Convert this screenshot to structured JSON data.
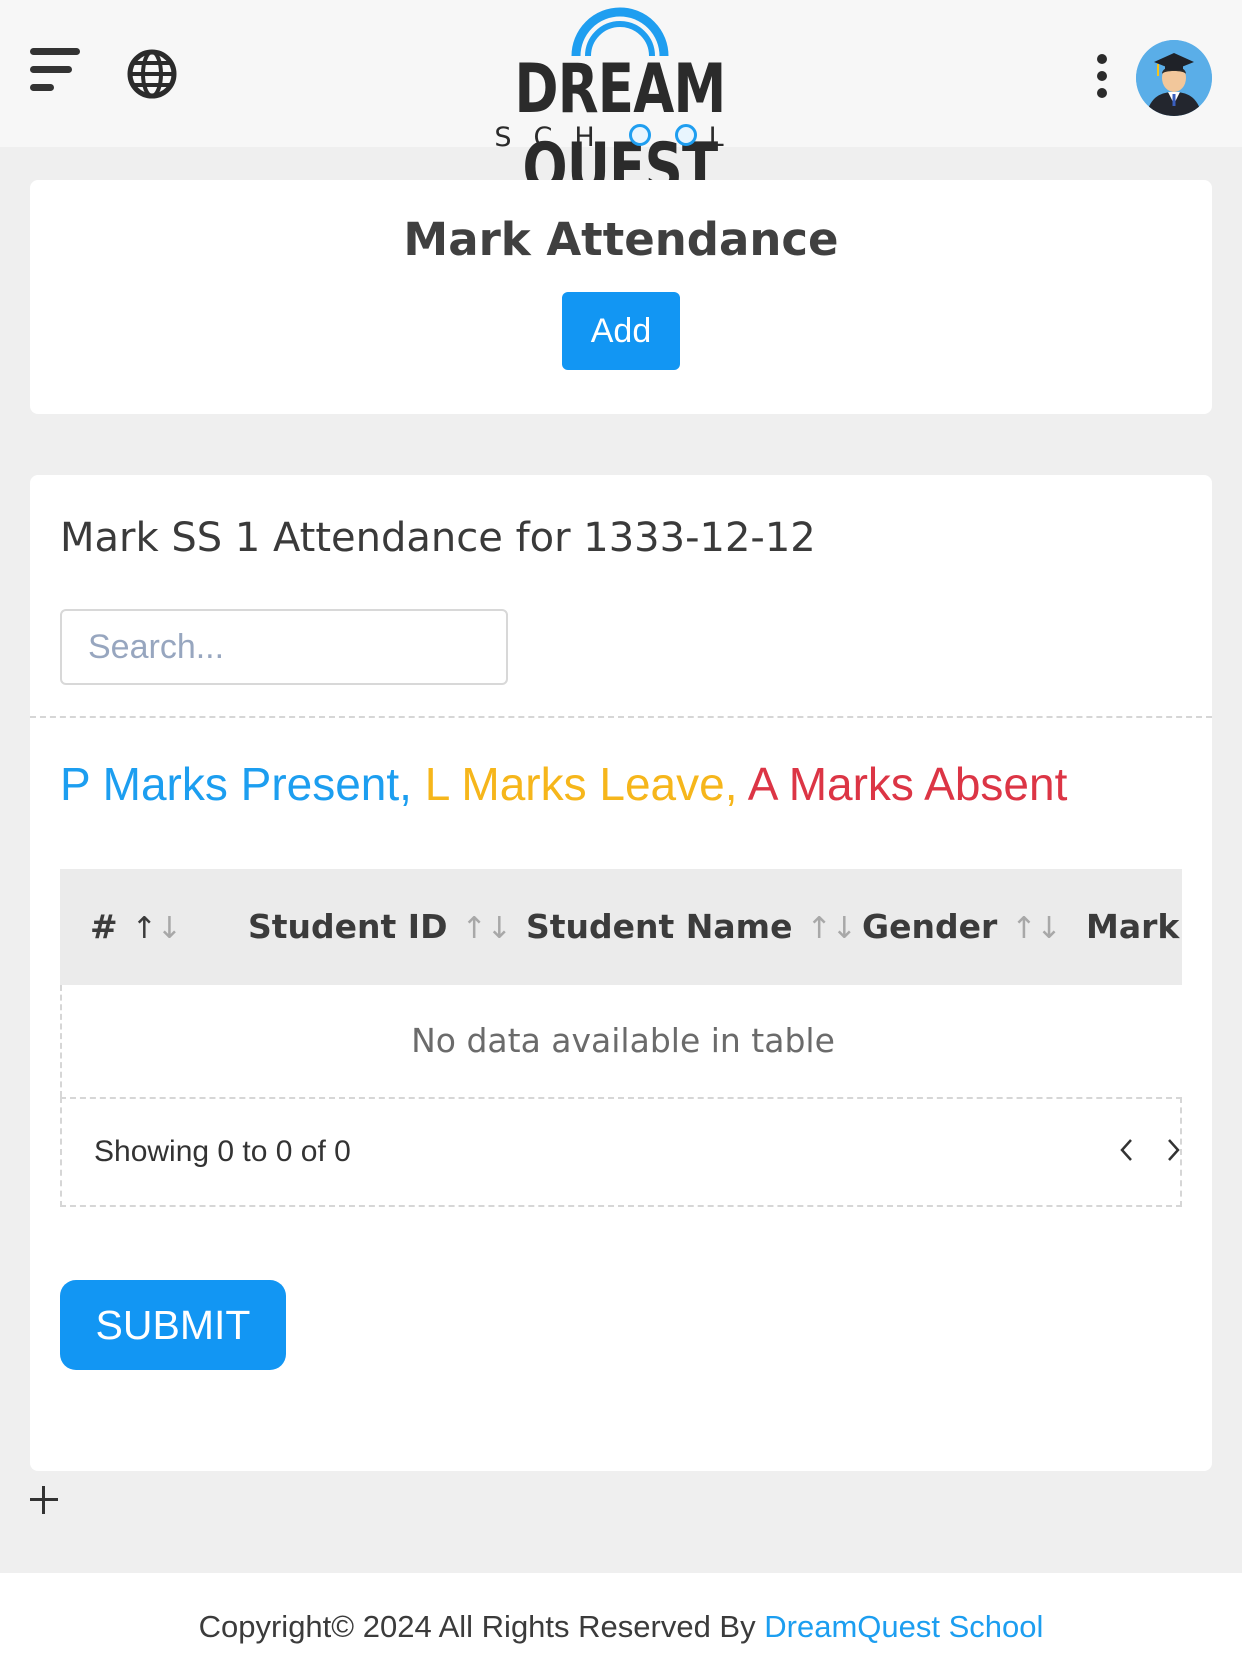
{
  "header": {
    "logo_title": "DREAM QUEST",
    "logo_sub_prefix": "SCH",
    "logo_sub_suffix": "L"
  },
  "attendance_card": {
    "title": "Mark Attendance",
    "add_label": "Add"
  },
  "table_section": {
    "title": "Mark SS 1 Attendance for 1333-12-12",
    "search_placeholder": "Search...",
    "legend": {
      "present": "P Marks Present,",
      "leave": "L Marks Leave,",
      "absent": "A Marks Absent",
      "colors": {
        "present": "#1c9ef0",
        "leave": "#f6b61b",
        "absent": "#dc3545"
      }
    },
    "columns": [
      "#",
      "Student ID",
      "Student Name",
      "Gender",
      "Mark"
    ],
    "empty_message": "No data available in table",
    "info": "Showing 0 to 0 of 0",
    "submit_label": "SUBMIT"
  },
  "footer": {
    "text": "Copyright© 2024 All Rights Reserved By",
    "link": "DreamQuest School"
  },
  "icons": [
    "menu-icon",
    "globe-icon",
    "more-vertical-icon",
    "avatar-graduate",
    "sort-icon",
    "chevron-left-icon",
    "chevron-right-icon",
    "plus-icon"
  ],
  "accent_color": "#1296f3"
}
